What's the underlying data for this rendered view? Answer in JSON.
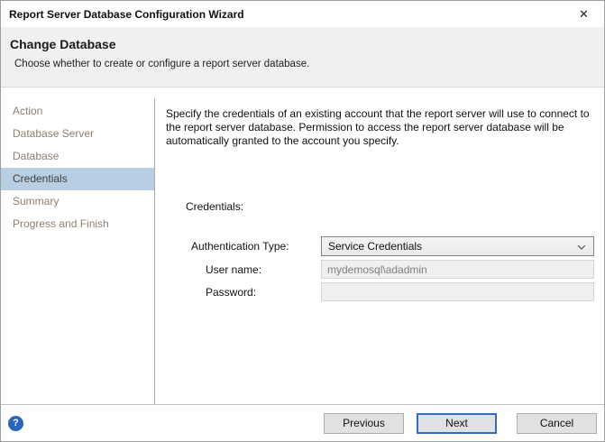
{
  "window": {
    "title": "Report Server Database Configuration Wizard",
    "close_icon_glyph": "✕"
  },
  "header": {
    "title": "Change Database",
    "subtitle": "Choose whether to create or configure a report server database."
  },
  "sidebar": {
    "items": [
      {
        "label": "Action",
        "selected": false
      },
      {
        "label": "Database Server",
        "selected": false
      },
      {
        "label": "Database",
        "selected": false
      },
      {
        "label": "Credentials",
        "selected": true
      },
      {
        "label": "Summary",
        "selected": false
      },
      {
        "label": "Progress and Finish",
        "selected": false
      }
    ],
    "selected_highlight_color": "#b8cee2",
    "item_text_color": "#8e7f70"
  },
  "content": {
    "description": "Specify the credentials of an existing account that the report server will use to connect to the report server database.  Permission to access the report server database will be automatically granted to the account you specify.",
    "section_label": "Credentials:",
    "fields": {
      "auth_type_label": "Authentication Type:",
      "auth_type_value": "Service Credentials",
      "username_label": "User name:",
      "username_value": "mydemosql\\adadmin",
      "password_label": "Password:",
      "password_value": ""
    }
  },
  "footer": {
    "help_icon_glyph": "?",
    "previous_label": "Previous",
    "next_label": "Next",
    "cancel_label": "Cancel",
    "primary_button_border_color": "#2e6fc0"
  }
}
